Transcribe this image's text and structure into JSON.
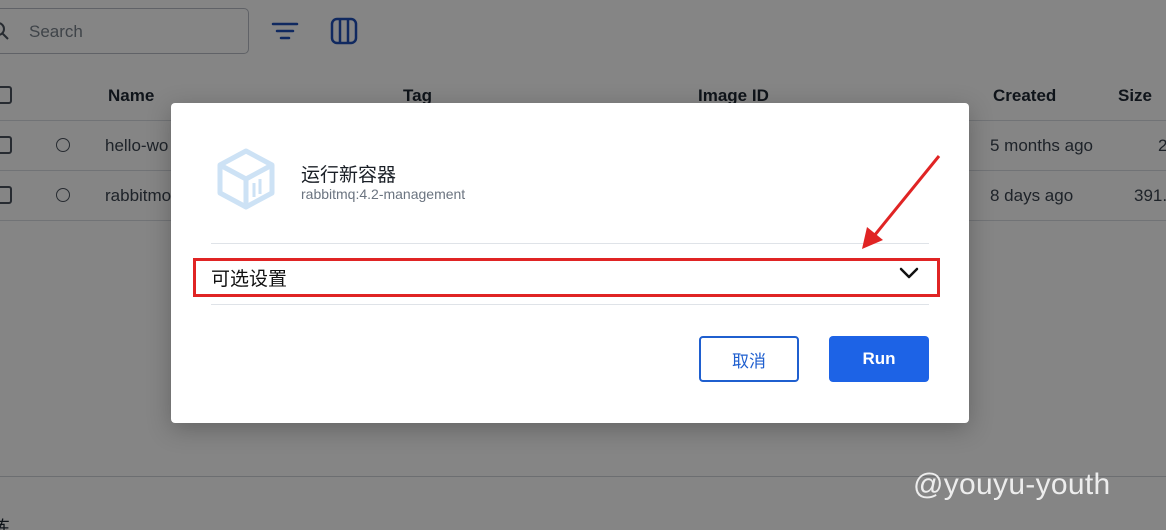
{
  "background": {
    "search_placeholder": "Search",
    "columns": [
      "Name",
      "Tag",
      "Image ID",
      "Created",
      "Size"
    ],
    "rows": [
      {
        "name": "hello-wo",
        "created": "5 months ago",
        "size": "2"
      },
      {
        "name": "rabbitmo",
        "created": "8 days ago",
        "size": "391."
      }
    ],
    "bottom_text": "练"
  },
  "modal": {
    "title": "运行新容器",
    "subtitle": "rabbitmq:4.2-management",
    "optional_settings_label": "可选设置",
    "cancel_label": "取消",
    "run_label": "Run"
  },
  "annotation": {
    "highlight_color": "#e02424"
  },
  "watermark": "@youyu-youth",
  "colors": {
    "primary": "#1d63e6",
    "overlay": "rgba(0,0,0,0.48)",
    "icon_accent": "#1f4fb8"
  },
  "icons": [
    "search-icon",
    "filter-icon",
    "columns-icon",
    "container-cube-icon",
    "chevron-down-icon"
  ]
}
